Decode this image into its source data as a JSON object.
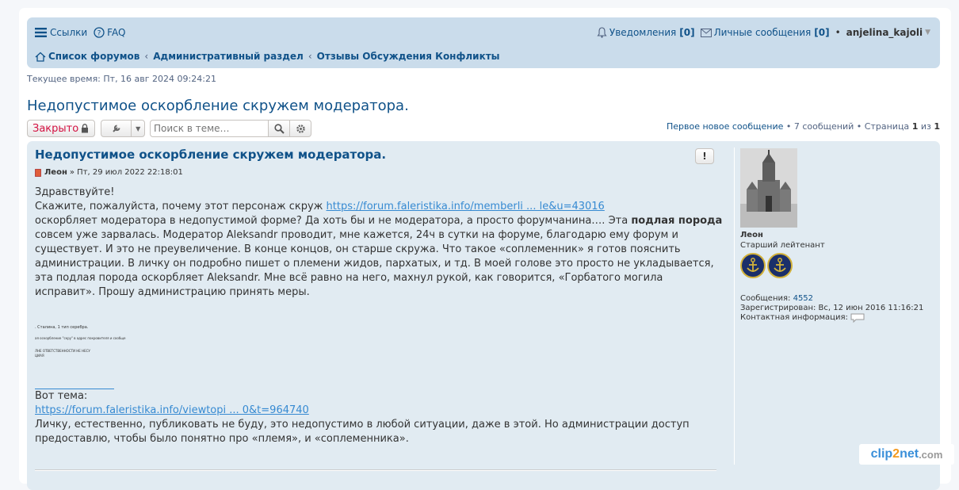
{
  "nav": {
    "links": "Ссылки",
    "faq": "FAQ",
    "notifications_label": "Уведомления",
    "notifications_count": "[0]",
    "messages_label": "Личные сообщения",
    "messages_count": "[0]",
    "bullet": "•",
    "username": "anjelina_kajoli"
  },
  "breadcrumbs": [
    "Список форумов",
    "Административный раздел",
    "Отзывы Обсуждения Конфликты"
  ],
  "current_time": "Текущее время: Пт, 16 авг 2024 09:24:21",
  "topic_title": "Недопустимое оскорбление скружем модератора.",
  "actions": {
    "locked_label": "Закрыто",
    "search_placeholder": "Поиск в теме…"
  },
  "pagination": {
    "first_new": "Первое новое сообщение",
    "posts": "7 сообщений",
    "page_label": "Страница",
    "page": "1",
    "of": "из",
    "total": "1",
    "sep": "•"
  },
  "post": {
    "title": "Недопустимое оскорбление скружем модератора.",
    "author": "Леон",
    "date": "» Пт, 29 июл 2022 22:18:01",
    "report": "!",
    "greeting": "Здравствуйте!",
    "line1_before": "Скажите, пожалуйста, почему этот персонаж скруж",
    "link1": "https://forum.faleristika.info/memberli ... le&u=43016",
    "para_a": "оскорбляет модератора в недопустимой форме? Да хоть бы и не модератора, а просто форумчанина…. Эта",
    "para_bold": "подлая порода",
    "para_b": "совсем уже зарвалась. Модератор Aleksandr проводит, мне кажется, 24ч в сутки на форуме, благодарю ему форум и существует. И это не преувеличение. В конце концов, он старше скружа. Что такое «соплеменник» я готов пояснить администрации. В личку он подробно пишет о племени жидов, пархатых, и тд. В моей голове это просто не укладывается, эта подлая порода оскорбляет Aleksandr. Мне всё равно на него, махнул рукой, как говорится, «Горбатого могила исправит». Прошу администрацию принять меры.",
    "attach_t1": ". Сталина, 1 тип серебра.",
    "attach_t2": "ая оскорбление \"скру\" в адрес покровителя и сообще",
    "attach_t3": "ЛНЕ ОТВЕТСТВЕННОСТИ НЕ НЕСУ",
    "attach_t4": "ЦИАЯ",
    "topic_label": "Вот тема:",
    "link2": "https://forum.faleristika.info/viewtopi ... 0&t=964740",
    "closing": "Личку, естественно, публиковать не буду, это недопустимо в любой ситуации, даже в этой. Но администрации доступ предоставлю, чтобы было понятно про «племя», и «соплеменника»."
  },
  "profile": {
    "name": "Леон",
    "rank": "Старший лейтенант",
    "posts_label": "Сообщения:",
    "posts_value": "4552",
    "registered_label": "Зарегистрирован:",
    "registered_value": "Вс, 12 июн 2016 11:16:21",
    "contact_label": "Контактная информация:"
  },
  "watermark": {
    "a": "clip",
    "b": "2",
    "c": "net",
    "d": ".com"
  }
}
